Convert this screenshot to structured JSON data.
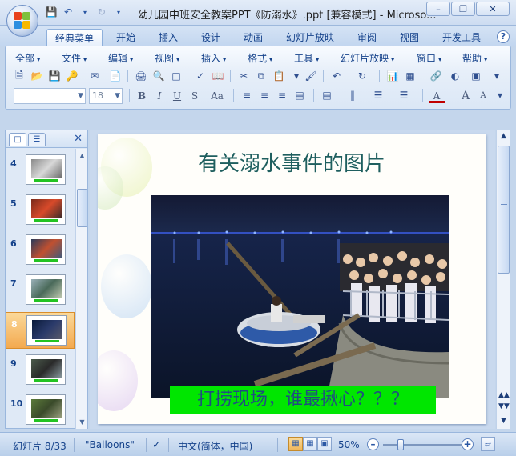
{
  "window": {
    "title": "幼儿园中班安全教案PPT《防溺水》.ppt [兼容模式] - Microso..."
  },
  "ribbon_tabs": [
    "经典菜单",
    "开始",
    "插入",
    "设计",
    "动画",
    "幻灯片放映",
    "审阅",
    "视图",
    "开发工具"
  ],
  "classic_menu": [
    "全部",
    "文件",
    "编辑",
    "视图",
    "插入",
    "格式",
    "工具",
    "幻灯片放映",
    "窗口",
    "帮助"
  ],
  "format_bar": {
    "font_name": "",
    "font_size": "18",
    "bold": "B",
    "italic": "I",
    "underline": "U",
    "strike": "S",
    "case": "Aa"
  },
  "thumbnails": [
    {
      "num": "4",
      "selected": false
    },
    {
      "num": "5",
      "selected": false
    },
    {
      "num": "6",
      "selected": false
    },
    {
      "num": "7",
      "selected": false
    },
    {
      "num": "8",
      "selected": true
    },
    {
      "num": "9",
      "selected": false
    },
    {
      "num": "10",
      "selected": false
    }
  ],
  "slide": {
    "title": "有关溺水事件的图片",
    "caption": "打捞现场，谁最揪心？？？"
  },
  "status": {
    "slide_pos": "幻灯片 8/33",
    "theme": "\"Balloons\"",
    "language": "中文(简体，中国)",
    "zoom": "50%"
  },
  "zoom_value": 50,
  "colors": {
    "caption_bg": "#00e600",
    "title_text": "#1f5f5f",
    "selection": "#f3a94f"
  }
}
